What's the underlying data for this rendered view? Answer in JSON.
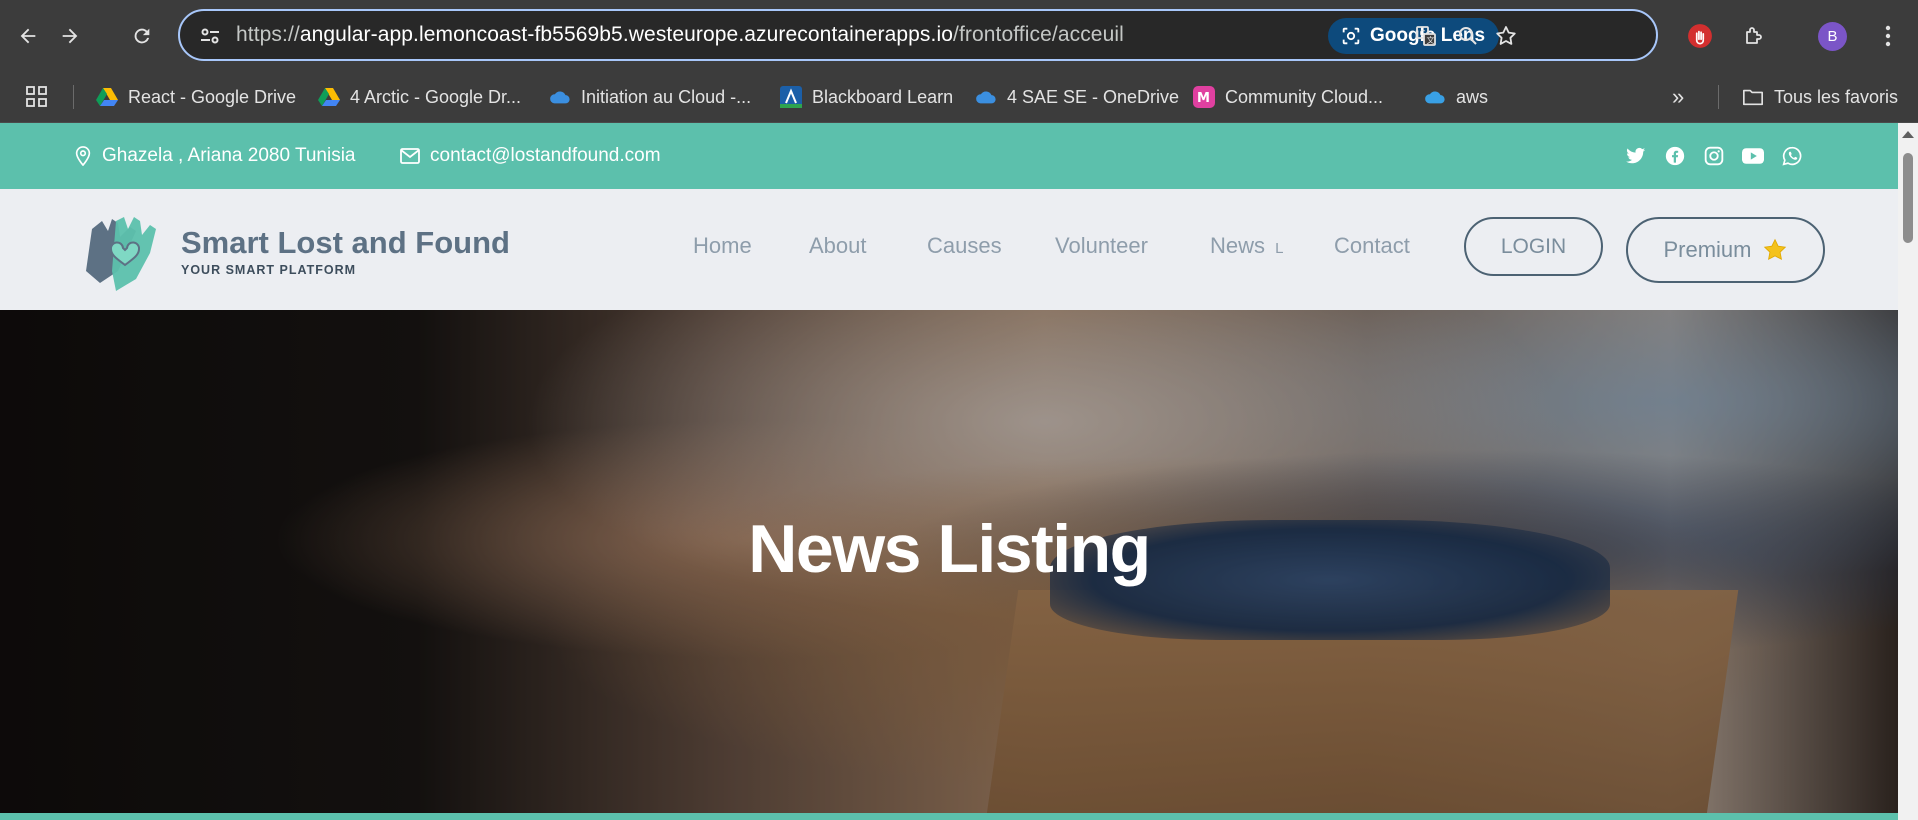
{
  "browser": {
    "url_prefix": "https://",
    "url_host": "angular-app.lemoncoast-fb5569b5.westeurope.azurecontainerapps.io",
    "url_path": "/frontoffice/acceuil",
    "lens_label": "Google Lens",
    "profile_initial": "B",
    "icons": {
      "back": "arrow-left-icon",
      "forward": "arrow-right-icon",
      "reload": "reload-icon",
      "site_info": "tune-icon",
      "translate": "translate-icon",
      "zoom": "zoom-icon",
      "bookmark": "star-icon",
      "extension_red": "hand-stop-icon",
      "extensions": "puzzle-icon",
      "menu": "kebab-menu-icon"
    }
  },
  "bookmarks": {
    "items": [
      {
        "label": "React - Google Drive",
        "icon": "google-drive-icon"
      },
      {
        "label": "4 Arctic - Google Dr...",
        "icon": "google-drive-icon"
      },
      {
        "label": "Initiation au Cloud -...",
        "icon": "onedrive-icon"
      },
      {
        "label": "Blackboard Learn",
        "icon": "blackboard-icon"
      },
      {
        "label": "4 SAE SE - OneDrive",
        "icon": "onedrive-icon"
      },
      {
        "label": "Community Cloud...",
        "icon": "m-app-icon"
      },
      {
        "label": "aws",
        "icon": "salesforce-cloud-icon"
      }
    ],
    "overflow_label": "»",
    "all_bookmarks_label": "Tous les favoris"
  },
  "topbar": {
    "address": "Ghazela , Ariana 2080 Tunisia",
    "email": "contact@lostandfound.com",
    "social": [
      "twitter-icon",
      "facebook-icon",
      "instagram-icon",
      "youtube-icon",
      "whatsapp-icon"
    ]
  },
  "header": {
    "brand_name": "Smart Lost and Found",
    "brand_tagline": "YOUR SMART PLATFORM",
    "nav": [
      "Home",
      "About",
      "Causes",
      "Volunteer",
      "News",
      "Contact"
    ],
    "news_suffix": "L",
    "login_label": "LOGIN",
    "premium_label": "Premium"
  },
  "hero": {
    "title": "News Listing"
  },
  "colors": {
    "accent": "#5cc0ac",
    "brand_text": "#5d7184",
    "header_bg": "#eceef2",
    "nav_text": "#8e9dab",
    "star": "#f4c21b"
  }
}
